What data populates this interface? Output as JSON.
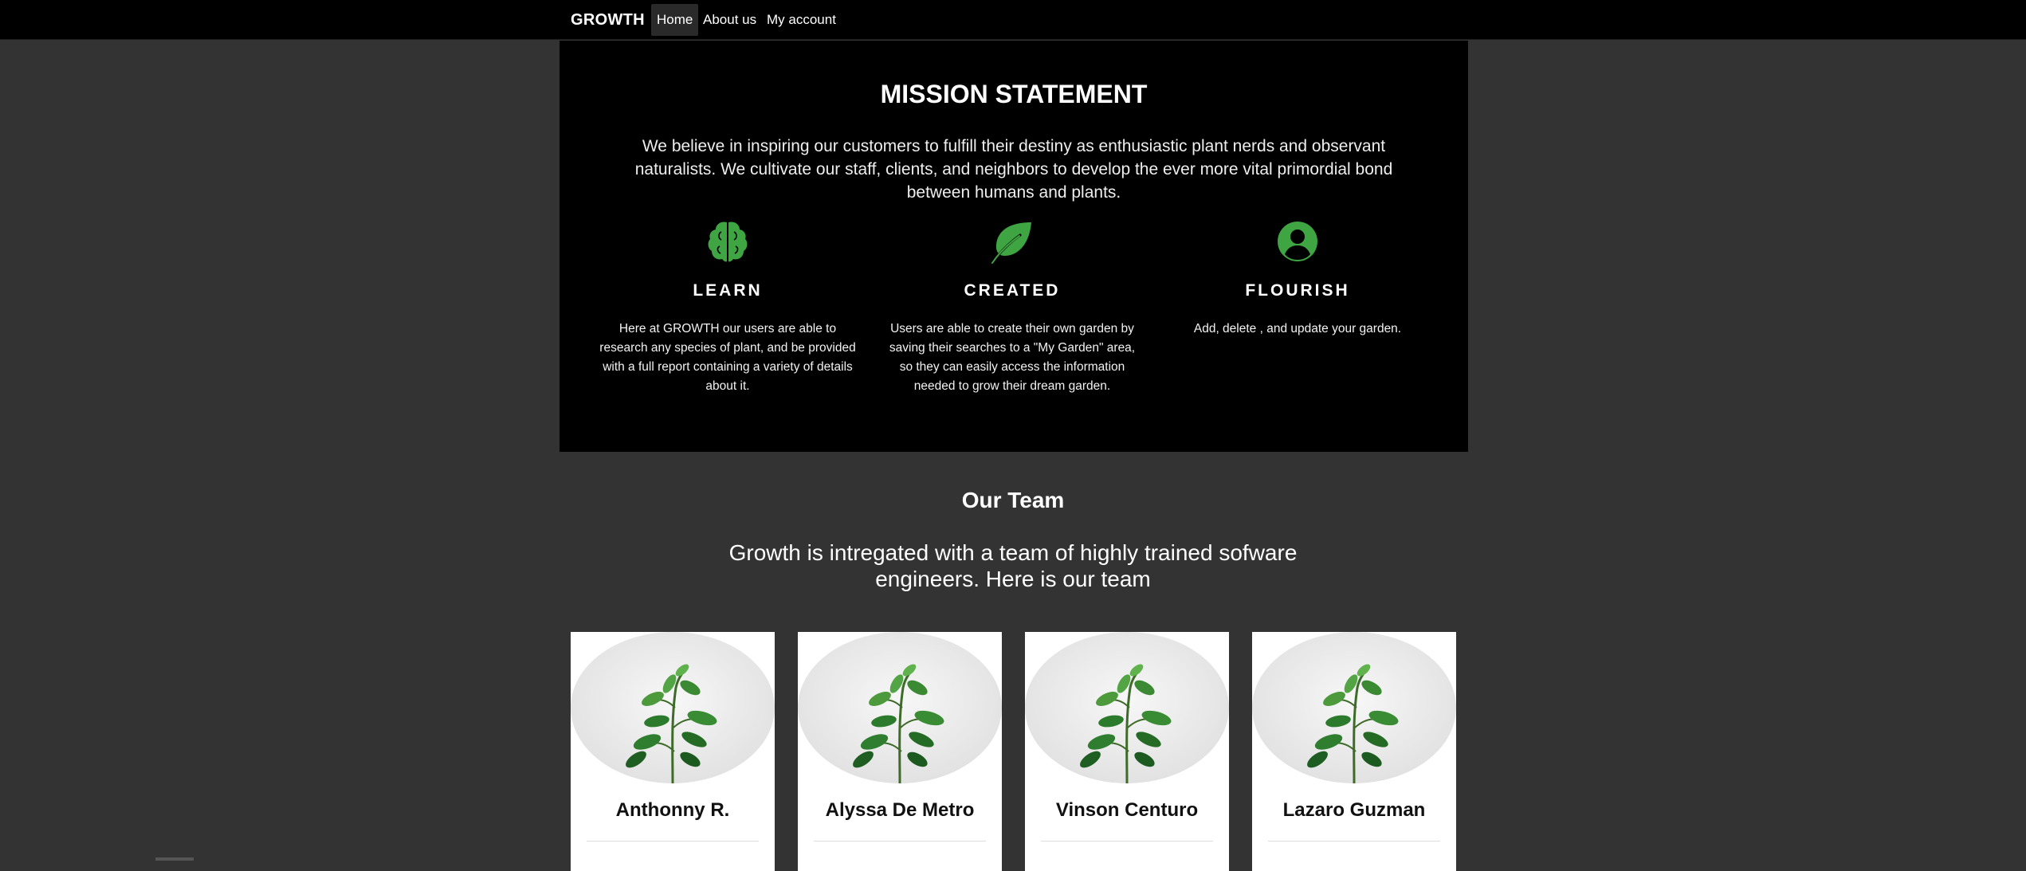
{
  "nav": {
    "brand": "GROWTH",
    "items": [
      {
        "label": "Home",
        "active": true
      },
      {
        "label": "About us",
        "active": false
      },
      {
        "label": "My account",
        "active": false
      }
    ]
  },
  "mission": {
    "title": "MISSION STATEMENT",
    "text": "We believe in inspiring our customers to fulfill their destiny as enthusiastic plant nerds and observant naturalists. We cultivate our staff, clients, and neighbors to develop the ever more vital primordial bond between humans and plants.",
    "features": [
      {
        "icon": "brain-icon",
        "title": "LEARN",
        "text": "Here at GROWTH our users are able to research any species of plant, and be provided with a full report containing a variety of details about it."
      },
      {
        "icon": "leaf-icon",
        "title": "CREATED",
        "text": "Users are able to create their own garden by saving their searches to a \"My Garden\" area, so they can easily access the information needed to grow their dream garden."
      },
      {
        "icon": "user-circle-icon",
        "title": "FLOURISH",
        "text": "Add, delete , and update your garden."
      }
    ]
  },
  "team": {
    "title": "Our Team",
    "subtitle": "Growth is intregated with a team of highly trained sofware engineers. Here is our team",
    "members": [
      {
        "name": "Anthonny R."
      },
      {
        "name": "Alyssa De Metro"
      },
      {
        "name": "Vinson Centuro"
      },
      {
        "name": "Lazaro Guzman"
      }
    ]
  },
  "colors": {
    "accent": "#3fa442",
    "background": "#333333",
    "panel": "#000000"
  }
}
